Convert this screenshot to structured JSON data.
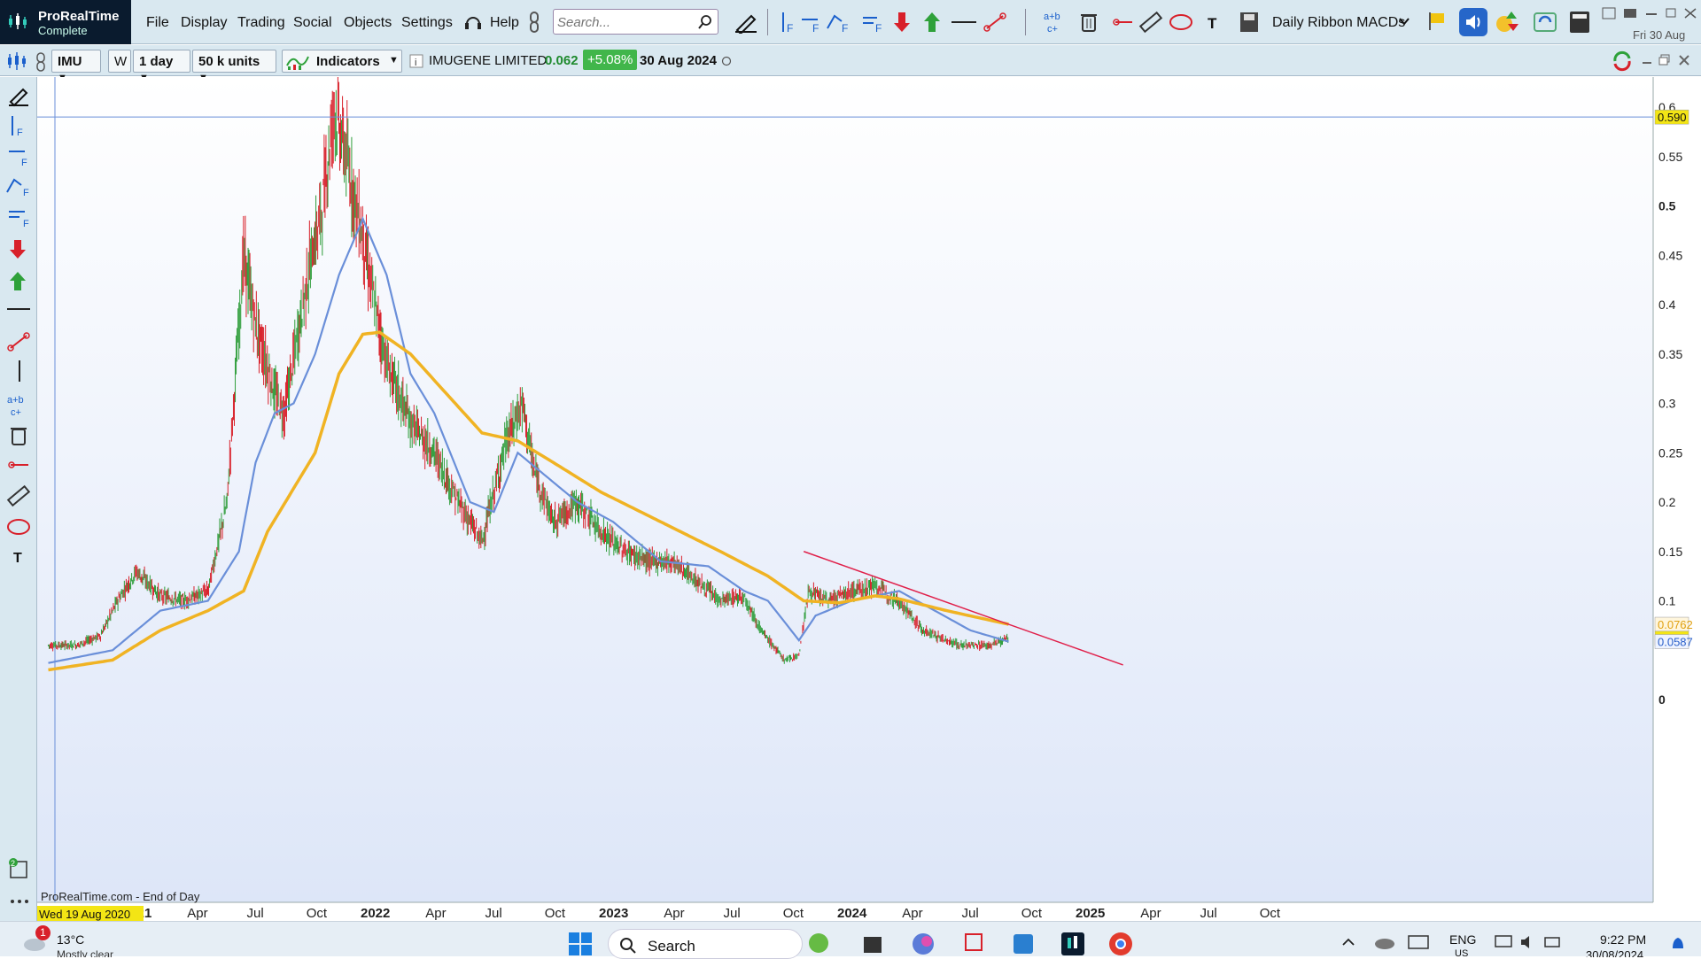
{
  "app": {
    "name": "ProRealTime",
    "edition": "Complete",
    "date": "Fri 30 Aug"
  },
  "menu": [
    "File",
    "Display",
    "Trading",
    "Social",
    "Objects",
    "Settings",
    "Help"
  ],
  "search_placeholder": "Search...",
  "layout_name": "Daily Ribbon MACDs",
  "toolbar": {
    "ticker": "IMU",
    "w_label": "W",
    "period": "1 day",
    "units": "50 k units",
    "indicators": "Indicators",
    "instrument": "IMUGENE LIMITED",
    "price": "0.062",
    "change": "+5.08%",
    "date": "30 Aug 2024"
  },
  "chart_data": {
    "type": "candlestick",
    "source_note": "ProRealTime.com - End of Day",
    "cursor_date": "Wed 19 Aug 2020",
    "x_labels": [
      "2021",
      "Apr",
      "Jul",
      "Oct",
      "2022",
      "Apr",
      "Jul",
      "Oct",
      "2023",
      "Apr",
      "Jul",
      "Oct",
      "2024",
      "Apr",
      "Jul",
      "Oct",
      "2025",
      "Apr",
      "Jul",
      "Oct"
    ],
    "x_label_bold": [
      "2021",
      "2022",
      "2023",
      "2024",
      "2025"
    ],
    "y_ticks": [
      "0.6",
      "0.55",
      "0.5",
      "0.45",
      "0.4",
      "0.35",
      "0.3",
      "0.25",
      "0.2",
      "0.15",
      "0.1",
      "0"
    ],
    "ylim": [
      0,
      0.63
    ],
    "price_line": 0.59,
    "price_line_label": "0.590",
    "last_price_label": "0.062",
    "ma_long_label": "0.0762",
    "ma_short_label": "0.0587",
    "series": [
      {
        "name": "close",
        "color": "#2e9d3a",
        "points": [
          [
            2020.63,
            0.055
          ],
          [
            2020.75,
            0.055
          ],
          [
            2020.85,
            0.065
          ],
          [
            2020.92,
            0.1
          ],
          [
            2021.0,
            0.13
          ],
          [
            2021.1,
            0.105
          ],
          [
            2021.2,
            0.1
          ],
          [
            2021.3,
            0.11
          ],
          [
            2021.38,
            0.2
          ],
          [
            2021.45,
            0.45
          ],
          [
            2021.5,
            0.38
          ],
          [
            2021.58,
            0.31
          ],
          [
            2021.62,
            0.29
          ],
          [
            2021.67,
            0.36
          ],
          [
            2021.72,
            0.43
          ],
          [
            2021.78,
            0.5
          ],
          [
            2021.83,
            0.6
          ],
          [
            2021.88,
            0.55
          ],
          [
            2021.94,
            0.48
          ],
          [
            2022.0,
            0.4
          ],
          [
            2022.05,
            0.34
          ],
          [
            2022.15,
            0.28
          ],
          [
            2022.25,
            0.25
          ],
          [
            2022.35,
            0.2
          ],
          [
            2022.45,
            0.16
          ],
          [
            2022.55,
            0.26
          ],
          [
            2022.62,
            0.3
          ],
          [
            2022.67,
            0.23
          ],
          [
            2022.75,
            0.18
          ],
          [
            2022.85,
            0.2
          ],
          [
            2022.95,
            0.17
          ],
          [
            2023.05,
            0.15
          ],
          [
            2023.15,
            0.14
          ],
          [
            2023.25,
            0.14
          ],
          [
            2023.35,
            0.12
          ],
          [
            2023.45,
            0.1
          ],
          [
            2023.55,
            0.105
          ],
          [
            2023.62,
            0.07
          ],
          [
            2023.72,
            0.04
          ],
          [
            2023.78,
            0.045
          ],
          [
            2023.82,
            0.11
          ],
          [
            2023.9,
            0.1
          ],
          [
            2024.0,
            0.11
          ],
          [
            2024.1,
            0.115
          ],
          [
            2024.2,
            0.1
          ],
          [
            2024.3,
            0.07
          ],
          [
            2024.45,
            0.055
          ],
          [
            2024.58,
            0.055
          ],
          [
            2024.66,
            0.062
          ]
        ]
      },
      {
        "name": "ma_short",
        "color": "#6a8fd9",
        "points": [
          [
            2020.63,
            0.037
          ],
          [
            2020.9,
            0.05
          ],
          [
            2021.1,
            0.09
          ],
          [
            2021.3,
            0.1
          ],
          [
            2021.43,
            0.15
          ],
          [
            2021.5,
            0.24
          ],
          [
            2021.58,
            0.29
          ],
          [
            2021.66,
            0.3
          ],
          [
            2021.75,
            0.35
          ],
          [
            2021.85,
            0.43
          ],
          [
            2021.95,
            0.487
          ],
          [
            2022.05,
            0.43
          ],
          [
            2022.15,
            0.33
          ],
          [
            2022.25,
            0.29
          ],
          [
            2022.4,
            0.2
          ],
          [
            2022.5,
            0.19
          ],
          [
            2022.6,
            0.25
          ],
          [
            2022.7,
            0.23
          ],
          [
            2022.85,
            0.2
          ],
          [
            2023.0,
            0.18
          ],
          [
            2023.2,
            0.14
          ],
          [
            2023.4,
            0.135
          ],
          [
            2023.55,
            0.11
          ],
          [
            2023.65,
            0.1
          ],
          [
            2023.78,
            0.06
          ],
          [
            2023.85,
            0.085
          ],
          [
            2024.0,
            0.1
          ],
          [
            2024.2,
            0.11
          ],
          [
            2024.35,
            0.09
          ],
          [
            2024.5,
            0.07
          ],
          [
            2024.66,
            0.0587
          ]
        ]
      },
      {
        "name": "ma_long",
        "color": "#f0b323",
        "points": [
          [
            2020.63,
            0.03
          ],
          [
            2020.9,
            0.04
          ],
          [
            2021.1,
            0.07
          ],
          [
            2021.3,
            0.09
          ],
          [
            2021.45,
            0.11
          ],
          [
            2021.55,
            0.17
          ],
          [
            2021.65,
            0.21
          ],
          [
            2021.75,
            0.25
          ],
          [
            2021.85,
            0.33
          ],
          [
            2021.95,
            0.37
          ],
          [
            2022.02,
            0.372
          ],
          [
            2022.15,
            0.35
          ],
          [
            2022.3,
            0.31
          ],
          [
            2022.45,
            0.27
          ],
          [
            2022.6,
            0.262
          ],
          [
            2022.75,
            0.24
          ],
          [
            2022.95,
            0.21
          ],
          [
            2023.2,
            0.18
          ],
          [
            2023.45,
            0.15
          ],
          [
            2023.65,
            0.125
          ],
          [
            2023.8,
            0.1
          ],
          [
            2023.95,
            0.098
          ],
          [
            2024.1,
            0.105
          ],
          [
            2024.2,
            0.102
          ],
          [
            2024.4,
            0.09
          ],
          [
            2024.66,
            0.0762
          ]
        ]
      }
    ],
    "trendline": {
      "color": "#e0204a",
      "from": [
        2023.8,
        0.15
      ],
      "to": [
        2025.14,
        0.035
      ]
    }
  },
  "taskbar": {
    "weather_temp": "13°C",
    "weather_desc": "Mostly clear",
    "notif_count": "1",
    "search": "Search",
    "lang": "ENG",
    "lang2": "US",
    "time": "9:22 PM",
    "date": "30/08/2024"
  }
}
